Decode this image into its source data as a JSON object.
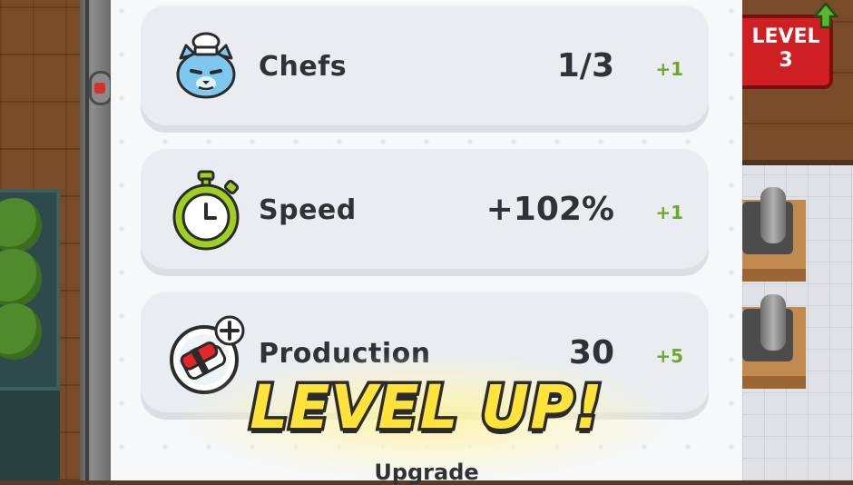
{
  "level_badge": {
    "line1": "LEVEL",
    "line2": "3"
  },
  "stats": [
    {
      "icon": "chef-cat-icon",
      "label": "Chefs",
      "value": "1/3",
      "bonus": "+1"
    },
    {
      "icon": "stopwatch-icon",
      "label": "Speed",
      "value": "+102%",
      "bonus": "+1"
    },
    {
      "icon": "sushi-plus-icon",
      "label": "Production",
      "value": "30",
      "bonus": "+5"
    }
  ],
  "banner": "LEVEL UP!",
  "upgrade_label": "Upgrade",
  "colors": {
    "bonus": "#6aa92a",
    "banner_fill": "#ffe33a",
    "badge": "#cf1f23"
  }
}
